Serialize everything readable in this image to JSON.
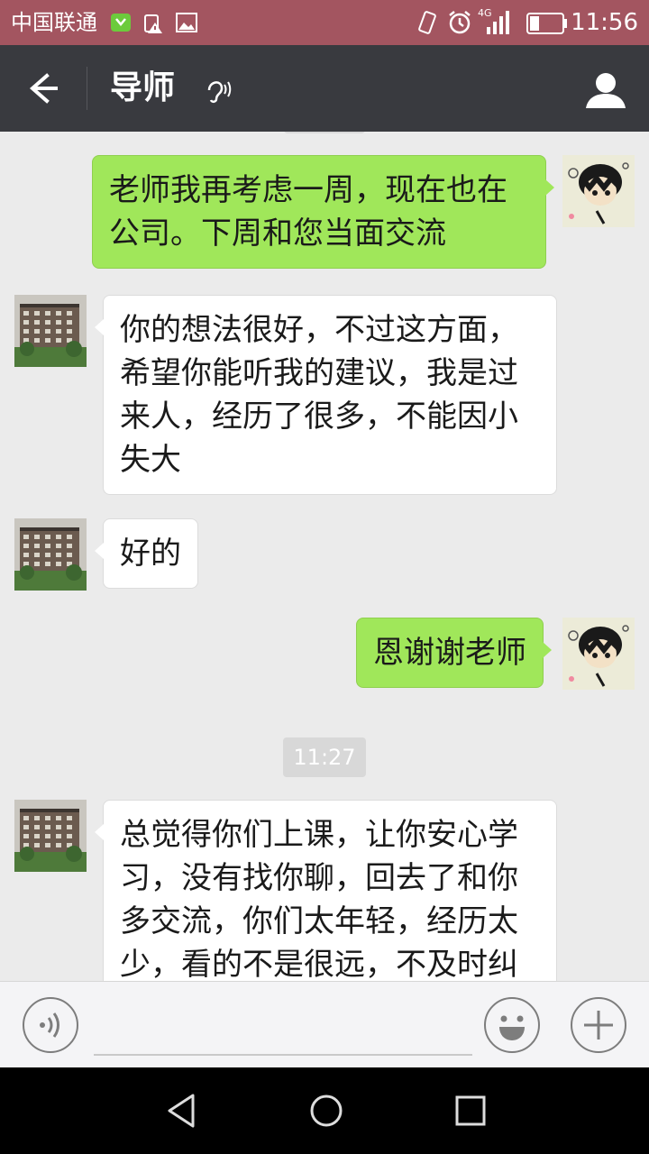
{
  "status_bar": {
    "carrier": "中国联通",
    "network": "4G",
    "time": "11:56",
    "icons": [
      "wechat-notification-icon",
      "warning-icon",
      "image-icon",
      "vibrate-icon",
      "alarm-icon",
      "signal-icon",
      "battery-icon"
    ]
  },
  "header": {
    "title": "导师",
    "icons": [
      "back-arrow-icon",
      "earpiece-mode-icon",
      "contact-profile-icon"
    ]
  },
  "messages": [
    {
      "direction": "out",
      "text": "老师我再考虑一周，现在也在公司。下周和您当面交流"
    },
    {
      "direction": "in",
      "text": "你的想法很好，不过这方面，希望你能听我的建议，我是过来人，经历了很多，不能因小失大"
    },
    {
      "direction": "in",
      "text": "好的"
    },
    {
      "direction": "out",
      "text": "恩谢谢老师"
    },
    {
      "direction": "in",
      "text": "总觉得你们上课，让你安心学习，没有找你聊，回去了和你多交流，你们太年轻，经历太少，看的不是很远，不及时纠"
    }
  ],
  "timestamp": "11:27",
  "input_bar": {
    "value": "",
    "icons": [
      "voice-input-icon",
      "emoji-icon",
      "more-plus-icon"
    ]
  },
  "nav_bar": {
    "icons": [
      "nav-back-icon",
      "nav-home-icon",
      "nav-recent-apps-icon"
    ]
  },
  "colors": {
    "status_bar": "#a35560",
    "header": "#393a3f",
    "chat_background": "#ebebeb",
    "outgoing_bubble": "#a0e75a",
    "incoming_bubble": "#ffffff"
  }
}
